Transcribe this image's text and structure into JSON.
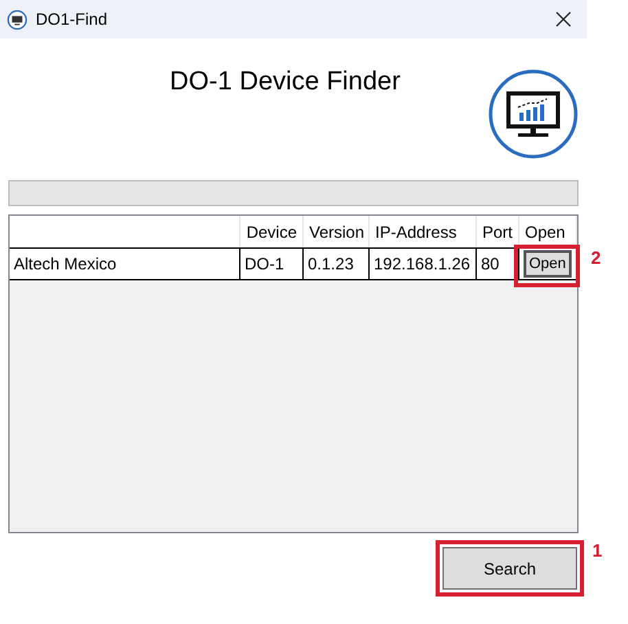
{
  "window": {
    "title": "DO1-Find"
  },
  "heading": "DO-1 Device Finder",
  "progress": {
    "level": 0
  },
  "table": {
    "columns": [
      "",
      "Device",
      "Version",
      "IP-Address",
      "Port",
      "Open"
    ],
    "rows": [
      {
        "cells": [
          "Altech Mexico",
          "DO-1",
          "0.1.23",
          "192.168.1.26",
          "80"
        ],
        "button": "Open"
      }
    ]
  },
  "search_button": "Search",
  "annotations": [
    {
      "label": "2"
    },
    {
      "label": "1"
    }
  ]
}
